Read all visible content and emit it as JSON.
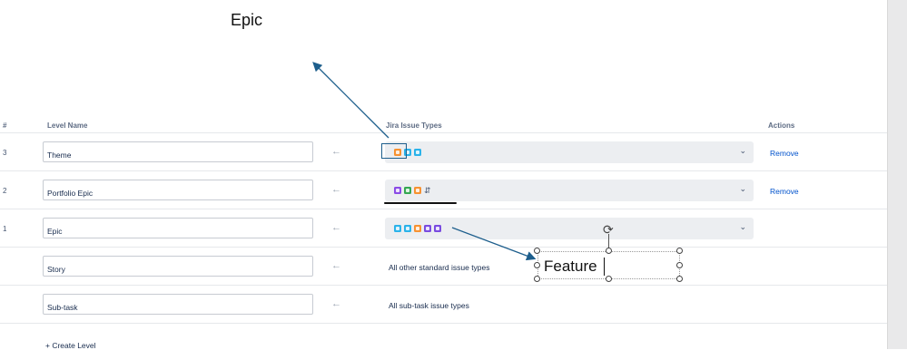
{
  "annotation": {
    "epic_label": "Epic",
    "feature_label": "Feature"
  },
  "table": {
    "headers": {
      "num": "#",
      "level_name": "Level Name",
      "issue_types": "Jira Issue Types",
      "actions": "Actions"
    },
    "rows": [
      {
        "num": "3",
        "level_name": "Theme",
        "issue_types_text": "",
        "action": "Remove",
        "icons": [
          {
            "name": "epic-orange-icon",
            "color": "#f79232"
          },
          {
            "name": "story-teal-icon",
            "color": "#2bb3ea"
          },
          {
            "name": "task-teal-icon",
            "color": "#2bb3ea"
          }
        ]
      },
      {
        "num": "2",
        "level_name": "Portfolio Epic",
        "issue_types_text": "",
        "action": "Remove",
        "icons": [
          {
            "name": "purple-circle-icon",
            "color": "#8b4ce6"
          },
          {
            "name": "green-plus-icon",
            "color": "#35a853"
          },
          {
            "name": "epic-orange-icon",
            "color": "#f79232"
          },
          {
            "name": "hierarchy-icon",
            "color": "#42526e"
          }
        ]
      },
      {
        "num": "1",
        "level_name": "Epic",
        "issue_types_text": "",
        "action": "",
        "icons": [
          {
            "name": "code-blue-icon",
            "color": "#2bb3ea"
          },
          {
            "name": "story-blue-icon",
            "color": "#2bb3ea"
          },
          {
            "name": "epic-orange-icon",
            "color": "#f79232"
          },
          {
            "name": "purple-lightning-icon",
            "color": "#7a4ce0"
          },
          {
            "name": "purple-bolt-icon",
            "color": "#7a4ce0"
          }
        ]
      },
      {
        "num": "",
        "level_name": "Story",
        "issue_types_text": "All other standard issue types",
        "action": ""
      },
      {
        "num": "",
        "level_name": "Sub-task",
        "issue_types_text": "All sub-task issue types",
        "action": ""
      }
    ]
  },
  "create_level": "+ Create Level",
  "colors": {
    "link": "#0052cc",
    "annotation_arrow": "#1d5e8c",
    "select_bg": "#eceef1"
  }
}
